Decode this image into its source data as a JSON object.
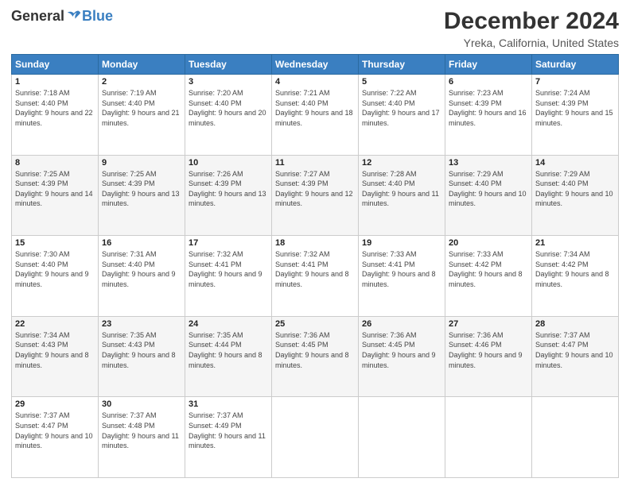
{
  "logo": {
    "general": "General",
    "blue": "Blue"
  },
  "header": {
    "title": "December 2024",
    "subtitle": "Yreka, California, United States"
  },
  "weekdays": [
    "Sunday",
    "Monday",
    "Tuesday",
    "Wednesday",
    "Thursday",
    "Friday",
    "Saturday"
  ],
  "weeks": [
    [
      {
        "day": "1",
        "sunrise": "7:18 AM",
        "sunset": "4:40 PM",
        "daylight": "9 hours and 22 minutes."
      },
      {
        "day": "2",
        "sunrise": "7:19 AM",
        "sunset": "4:40 PM",
        "daylight": "9 hours and 21 minutes."
      },
      {
        "day": "3",
        "sunrise": "7:20 AM",
        "sunset": "4:40 PM",
        "daylight": "9 hours and 20 minutes."
      },
      {
        "day": "4",
        "sunrise": "7:21 AM",
        "sunset": "4:40 PM",
        "daylight": "9 hours and 18 minutes."
      },
      {
        "day": "5",
        "sunrise": "7:22 AM",
        "sunset": "4:40 PM",
        "daylight": "9 hours and 17 minutes."
      },
      {
        "day": "6",
        "sunrise": "7:23 AM",
        "sunset": "4:39 PM",
        "daylight": "9 hours and 16 minutes."
      },
      {
        "day": "7",
        "sunrise": "7:24 AM",
        "sunset": "4:39 PM",
        "daylight": "9 hours and 15 minutes."
      }
    ],
    [
      {
        "day": "8",
        "sunrise": "7:25 AM",
        "sunset": "4:39 PM",
        "daylight": "9 hours and 14 minutes."
      },
      {
        "day": "9",
        "sunrise": "7:25 AM",
        "sunset": "4:39 PM",
        "daylight": "9 hours and 13 minutes."
      },
      {
        "day": "10",
        "sunrise": "7:26 AM",
        "sunset": "4:39 PM",
        "daylight": "9 hours and 13 minutes."
      },
      {
        "day": "11",
        "sunrise": "7:27 AM",
        "sunset": "4:39 PM",
        "daylight": "9 hours and 12 minutes."
      },
      {
        "day": "12",
        "sunrise": "7:28 AM",
        "sunset": "4:40 PM",
        "daylight": "9 hours and 11 minutes."
      },
      {
        "day": "13",
        "sunrise": "7:29 AM",
        "sunset": "4:40 PM",
        "daylight": "9 hours and 10 minutes."
      },
      {
        "day": "14",
        "sunrise": "7:29 AM",
        "sunset": "4:40 PM",
        "daylight": "9 hours and 10 minutes."
      }
    ],
    [
      {
        "day": "15",
        "sunrise": "7:30 AM",
        "sunset": "4:40 PM",
        "daylight": "9 hours and 9 minutes."
      },
      {
        "day": "16",
        "sunrise": "7:31 AM",
        "sunset": "4:40 PM",
        "daylight": "9 hours and 9 minutes."
      },
      {
        "day": "17",
        "sunrise": "7:32 AM",
        "sunset": "4:41 PM",
        "daylight": "9 hours and 9 minutes."
      },
      {
        "day": "18",
        "sunrise": "7:32 AM",
        "sunset": "4:41 PM",
        "daylight": "9 hours and 8 minutes."
      },
      {
        "day": "19",
        "sunrise": "7:33 AM",
        "sunset": "4:41 PM",
        "daylight": "9 hours and 8 minutes."
      },
      {
        "day": "20",
        "sunrise": "7:33 AM",
        "sunset": "4:42 PM",
        "daylight": "9 hours and 8 minutes."
      },
      {
        "day": "21",
        "sunrise": "7:34 AM",
        "sunset": "4:42 PM",
        "daylight": "9 hours and 8 minutes."
      }
    ],
    [
      {
        "day": "22",
        "sunrise": "7:34 AM",
        "sunset": "4:43 PM",
        "daylight": "9 hours and 8 minutes."
      },
      {
        "day": "23",
        "sunrise": "7:35 AM",
        "sunset": "4:43 PM",
        "daylight": "9 hours and 8 minutes."
      },
      {
        "day": "24",
        "sunrise": "7:35 AM",
        "sunset": "4:44 PM",
        "daylight": "9 hours and 8 minutes."
      },
      {
        "day": "25",
        "sunrise": "7:36 AM",
        "sunset": "4:45 PM",
        "daylight": "9 hours and 8 minutes."
      },
      {
        "day": "26",
        "sunrise": "7:36 AM",
        "sunset": "4:45 PM",
        "daylight": "9 hours and 9 minutes."
      },
      {
        "day": "27",
        "sunrise": "7:36 AM",
        "sunset": "4:46 PM",
        "daylight": "9 hours and 9 minutes."
      },
      {
        "day": "28",
        "sunrise": "7:37 AM",
        "sunset": "4:47 PM",
        "daylight": "9 hours and 10 minutes."
      }
    ],
    [
      {
        "day": "29",
        "sunrise": "7:37 AM",
        "sunset": "4:47 PM",
        "daylight": "9 hours and 10 minutes."
      },
      {
        "day": "30",
        "sunrise": "7:37 AM",
        "sunset": "4:48 PM",
        "daylight": "9 hours and 11 minutes."
      },
      {
        "day": "31",
        "sunrise": "7:37 AM",
        "sunset": "4:49 PM",
        "daylight": "9 hours and 11 minutes."
      },
      null,
      null,
      null,
      null
    ]
  ],
  "labels": {
    "sunrise": "Sunrise:",
    "sunset": "Sunset:",
    "daylight": "Daylight:"
  }
}
